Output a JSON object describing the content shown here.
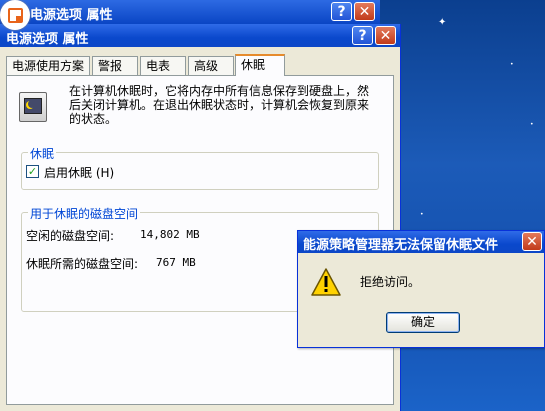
{
  "background_window": {
    "title": "电源选项 属性",
    "help_label": "?",
    "close_label": "✕"
  },
  "main_window": {
    "title": "电源选项 属性",
    "help_label": "?",
    "close_label": "✕",
    "tabs": [
      {
        "label": "电源使用方案"
      },
      {
        "label": "警报"
      },
      {
        "label": "电表"
      },
      {
        "label": "高级"
      },
      {
        "label": "休眠",
        "active": true
      }
    ],
    "description": "在计算机休眠时，它将内存中所有信息保存到硬盘上，然后关闭计算机。在退出休眠状态时，计算机会恢复到原来的状态。",
    "hibernate_group": {
      "title": "休眠",
      "checkbox_label": "启用休眠 (H)",
      "checked": true
    },
    "disk_group": {
      "title": "用于休眠的磁盘空间",
      "free_label": "空闲的磁盘空间:",
      "free_value": "14,802 MB",
      "required_label": "休眠所需的磁盘空间:",
      "required_value": "767 MB"
    }
  },
  "dialog": {
    "title": "能源策略管理器无法保留休眠文件",
    "message": "拒绝访问。",
    "ok_label": "确定",
    "close_label": "✕"
  },
  "colors": {
    "titlebar": "#0a48cc",
    "window_bg": "#ece9d8",
    "group_title": "#0046d5",
    "tab_accent": "#e68b2c",
    "desktop": "#134fae"
  },
  "icons": [
    "logo-badge-icon",
    "hibernate-icon",
    "warning-icon",
    "help-icon",
    "close-icon"
  ]
}
